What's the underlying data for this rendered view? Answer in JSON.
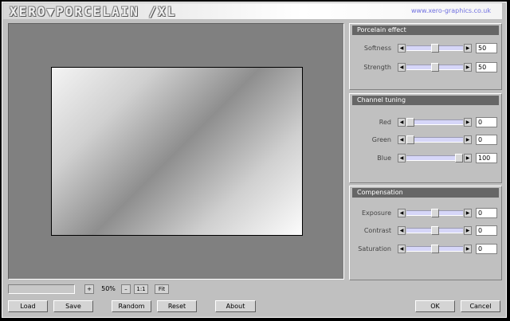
{
  "header": {
    "title": "XERO▼PORCELAIN /XL",
    "url": "www.xero-graphics.co.uk"
  },
  "panels": [
    {
      "title": "Porcelain effect",
      "sliders": [
        {
          "label": "Softness",
          "value": "50",
          "position": 0.5
        },
        {
          "label": "Strength",
          "value": "50",
          "position": 0.5
        }
      ]
    },
    {
      "title": "Channel tuning",
      "sliders": [
        {
          "label": "Red",
          "value": "0",
          "position": 0.0
        },
        {
          "label": "Green",
          "value": "0",
          "position": 0.0
        },
        {
          "label": "Blue",
          "value": "100",
          "position": 1.0
        }
      ]
    },
    {
      "title": "Compensation",
      "sliders": [
        {
          "label": "Exposure",
          "value": "0",
          "position": 0.5
        },
        {
          "label": "Contrast",
          "value": "0",
          "position": 0.5
        },
        {
          "label": "Saturation",
          "value": "0",
          "position": 0.5
        }
      ]
    }
  ],
  "zoom": {
    "plus": "+",
    "value": "50%",
    "minus": "–",
    "one_to_one": "1:1",
    "fit": "Fit"
  },
  "buttons": {
    "load": "Load",
    "save": "Save",
    "random": "Random",
    "reset": "Reset",
    "about": "About",
    "ok": "OK",
    "cancel": "Cancel"
  },
  "icons": {
    "slider_left": "arrow-left-icon",
    "slider_right": "arrow-right-icon"
  },
  "colors": {
    "slider_track": "#d6d6f8",
    "panel_header": "#666666",
    "url_text": "#7070e0"
  }
}
